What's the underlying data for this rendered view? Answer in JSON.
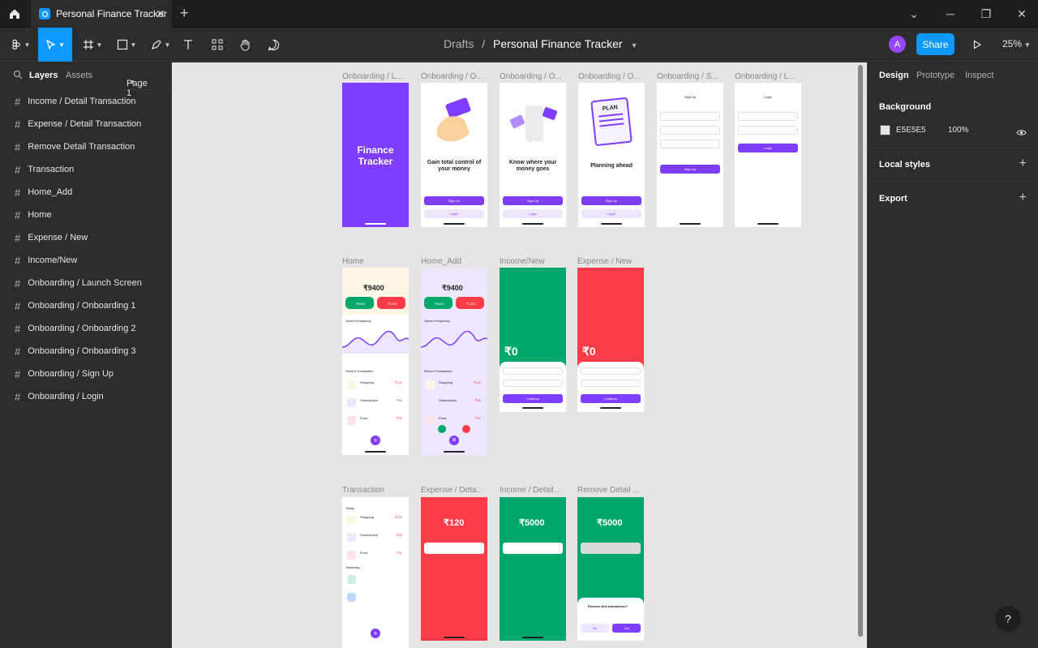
{
  "tab": {
    "title": "Personal Finance Tracker"
  },
  "toolbar": {
    "breadcrumb_root": "Drafts",
    "breadcrumb_sep": "/",
    "file_name": "Personal Finance Tracker",
    "avatar_initial": "A",
    "share_label": "Share",
    "zoom": "25%"
  },
  "left_panel": {
    "tab_layers": "Layers",
    "tab_assets": "Assets",
    "page": "Page 1",
    "layers": [
      "Income / Detail Transaction",
      "Expense / Detail Transaction",
      "Remove Detail Transaction",
      "Transaction",
      "Home_Add",
      "Home",
      "Expense / New",
      "Income/New",
      "Onboarding / Launch Screen",
      "Onboarding / Onboarding 1",
      "Onboarding / Onboarding 2",
      "Onboarding / Onboarding 3",
      "Onboarding / Sign Up",
      "Onboarding / Login"
    ]
  },
  "right_panel": {
    "tab_design": "Design",
    "tab_prototype": "Prototype",
    "tab_inspect": "Inspect",
    "background_label": "Background",
    "background_hex": "E5E5E5",
    "background_opacity": "100%",
    "local_styles": "Local styles",
    "export": "Export"
  },
  "canvas": {
    "frame_labels": {
      "launch": "Onboarding / L...",
      "ob1": "Onboarding / O...",
      "ob2": "Onboarding / O...",
      "ob3": "Onboarding / O...",
      "signup": "Onboarding / S...",
      "login": "Onboarding / L...",
      "home": "Home",
      "home_add": "Home_Add",
      "income_new": "Income/New",
      "expense_new": "Expense / New",
      "transaction": "Transaction",
      "expense_detail": "Expense / Deta...",
      "income_detail": "Income / Detail...",
      "remove_detail": "Remove Detail ..."
    },
    "launch_title": "Finance Tracker",
    "ob1_title": "Gain total control of your money",
    "ob2_title": "Know where your money goes",
    "ob3_title": "Planning ahead",
    "sign_up": "Sign Up",
    "login": "Login",
    "home_balance": "₹9400",
    "home_income": "₹5000",
    "home_expense": "₹1200",
    "spend_frequency": "Spend Frequency",
    "recent_transaction": "Recent Transaction",
    "tx_items": [
      {
        "name": "Shopping",
        "amount": "- ₹120"
      },
      {
        "name": "Subscription",
        "amount": "- ₹80"
      },
      {
        "name": "Food",
        "amount": "- ₹32"
      }
    ],
    "zero_amount": "₹0",
    "continue": "Continue",
    "expense_detail_amt": "₹120",
    "income_detail_amt": "₹5000",
    "remove_detail_amt": "₹5000",
    "remove_prompt": "Remove this transaction?",
    "no": "No",
    "yes": "Yes",
    "today": "Today",
    "yesterday": "Yesterday",
    "plan_word": "PLAN"
  },
  "colors": {
    "accent": "#0d99ff",
    "purple": "#7f3dff",
    "green": "#00a86b",
    "red": "#fd3c4a",
    "canvas_bg": "#e5e5e5"
  }
}
